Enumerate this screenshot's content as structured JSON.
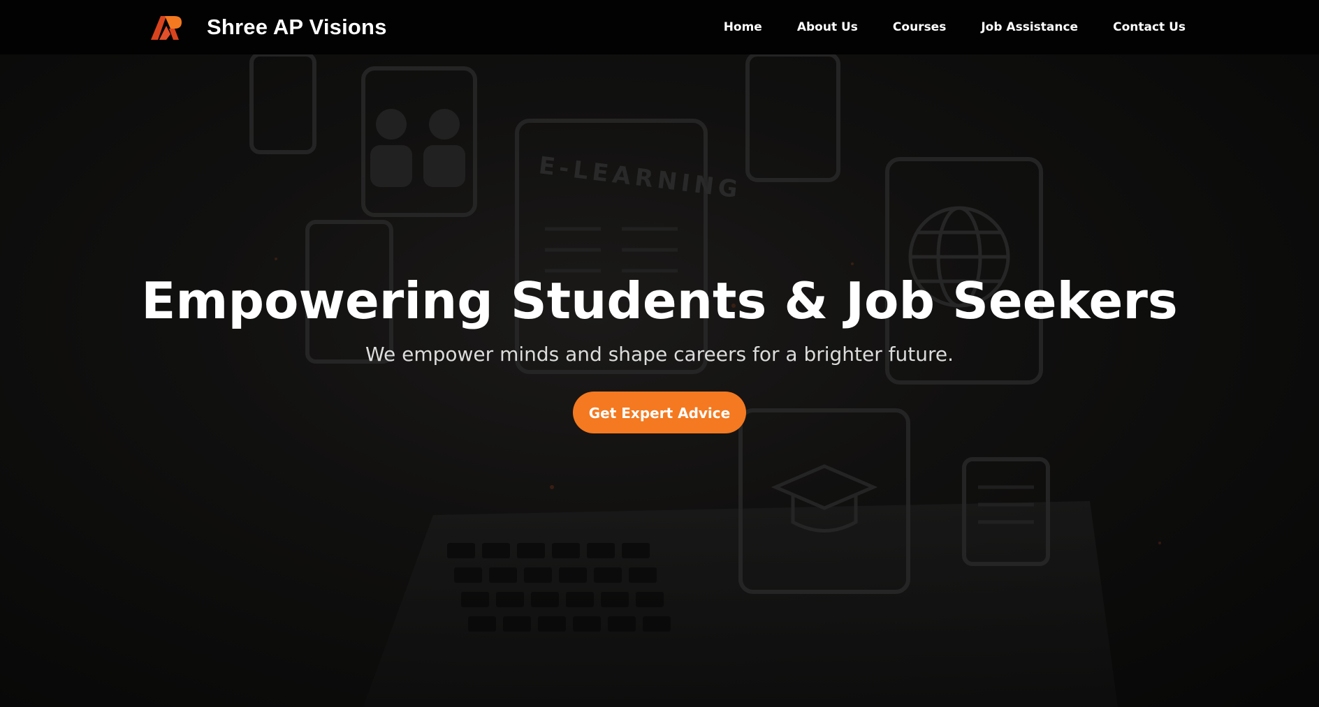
{
  "brand": {
    "name": "Shree AP Visions",
    "logo_icon": "ap-logo-icon",
    "logo_colors": [
      "#d9441e",
      "#f47920"
    ]
  },
  "nav": {
    "items": [
      {
        "label": "Home"
      },
      {
        "label": "About Us"
      },
      {
        "label": "Courses"
      },
      {
        "label": "Job Assistance"
      },
      {
        "label": "Contact Us"
      }
    ]
  },
  "hero": {
    "title": "Empowering Students & Job Seekers",
    "subtitle": "We empower minds and shape careers for a brighter future.",
    "cta_label": "Get Expert Advice",
    "background_icon": "e-learning-laptop-background",
    "background_text": "E-LEARNING"
  },
  "colors": {
    "accent": "#f47920",
    "navbar": "#020202",
    "text": "#ffffff"
  }
}
